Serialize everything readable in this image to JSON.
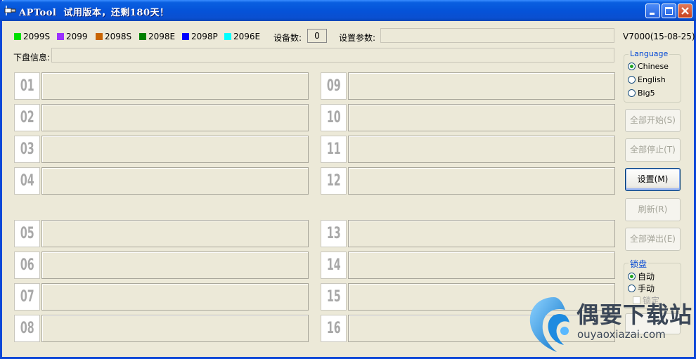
{
  "window": {
    "title": "APTool  试用版本，还剩180天！"
  },
  "legend": [
    {
      "label": "2099S",
      "color": "#00e000"
    },
    {
      "label": "2099",
      "color": "#9b30ff"
    },
    {
      "label": "2098S",
      "color": "#c86400"
    },
    {
      "label": "2098E",
      "color": "#008000"
    },
    {
      "label": "2098P",
      "color": "#0000ff"
    },
    {
      "label": "2096E",
      "color": "#00ffff"
    }
  ],
  "header": {
    "device_count_label": "设备数:",
    "device_count_value": "0",
    "settings_params_label": "设置参数:",
    "settings_params_value": "",
    "version": "V7000(15-08-25)",
    "disk_info_label": "下盘信息:",
    "disk_info_value": ""
  },
  "slots_left": [
    {
      "num": "01",
      "value": ""
    },
    {
      "num": "02",
      "value": ""
    },
    {
      "num": "03",
      "value": ""
    },
    {
      "num": "04",
      "value": ""
    },
    {
      "num": "05",
      "value": ""
    },
    {
      "num": "06",
      "value": ""
    },
    {
      "num": "07",
      "value": ""
    },
    {
      "num": "08",
      "value": ""
    }
  ],
  "slots_right": [
    {
      "num": "09",
      "value": ""
    },
    {
      "num": "10",
      "value": ""
    },
    {
      "num": "11",
      "value": ""
    },
    {
      "num": "12",
      "value": ""
    },
    {
      "num": "13",
      "value": ""
    },
    {
      "num": "14",
      "value": ""
    },
    {
      "num": "15",
      "value": ""
    },
    {
      "num": "16",
      "value": ""
    }
  ],
  "language": {
    "title": "Language",
    "options": [
      "Chinese",
      "English",
      "Big5"
    ],
    "selected": "Chinese"
  },
  "buttons": {
    "start_all": "全部开始(S)",
    "stop_all": "全部停止(T)",
    "settings": "设置(M)",
    "refresh": "刷新(R)",
    "eject_all": "全部弹出(E)"
  },
  "lock": {
    "title": "锁盘",
    "auto": "自动",
    "manual": "手动",
    "lock_label": "锁定",
    "selected": "自动"
  },
  "watermark": {
    "title": "偶要下载站",
    "url": "ouyaoxiazai.com"
  }
}
